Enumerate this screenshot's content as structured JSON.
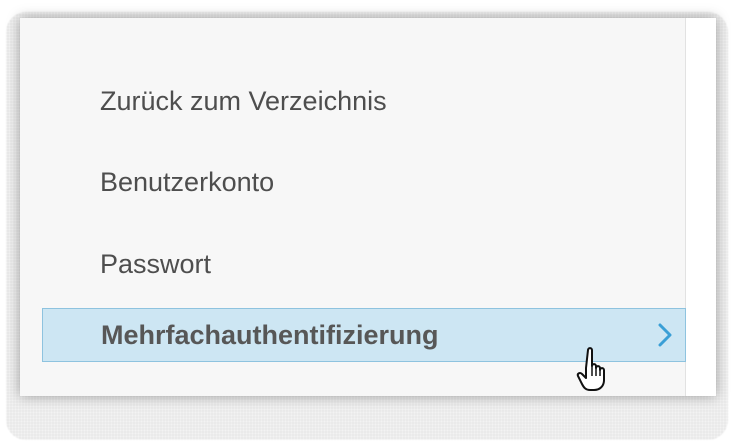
{
  "menu": {
    "items": [
      {
        "label": "Zurück zum Verzeichnis"
      },
      {
        "label": "Benutzerkonto"
      },
      {
        "label": "Passwort"
      },
      {
        "label": "Mehrfachauthentifizierung",
        "active": true
      }
    ]
  },
  "icons": {
    "chevron": "chevron-right-icon",
    "cursor": "hand-pointer-cursor-icon"
  },
  "colors": {
    "active_background": "#cde6f3",
    "active_border": "#8ec3df",
    "chevron": "#3a9fd6",
    "text": "#4e4e4e"
  }
}
